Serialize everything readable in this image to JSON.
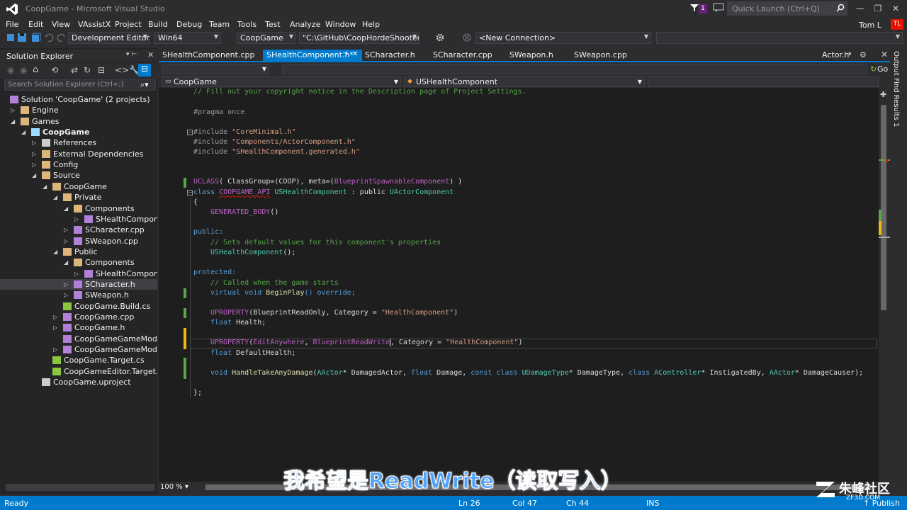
{
  "window": {
    "title": "CoopGame - Microsoft Visual Studio",
    "notification_count": "1",
    "quick_launch_placeholder": "Quick Launch (Ctrl+Q)",
    "user_name": "Tom L",
    "user_initials": "TL"
  },
  "menu": [
    "File",
    "Edit",
    "View",
    "VAssistX",
    "Project",
    "Build",
    "Debug",
    "Team",
    "Tools",
    "Test",
    "Analyze",
    "Window",
    "Help"
  ],
  "toolbar": {
    "configuration": "Development Editor",
    "platform": "Win64",
    "startup_project": "CoopGame",
    "path": "\"C:\\GitHub\\CoopHordeShooter\\Co",
    "connection": "<New Connection>"
  },
  "solution_explorer": {
    "title": "Solution Explorer",
    "search_placeholder": "Search Solution Explorer (Ctrl+;)",
    "items": [
      {
        "label": "Solution 'CoopGame' (2 projects)",
        "level": 0,
        "exp": "",
        "icon": "solution-icon"
      },
      {
        "label": "Engine",
        "level": 1,
        "exp": "▷",
        "icon": "folder-icon"
      },
      {
        "label": "Games",
        "level": 1,
        "exp": "◢",
        "icon": "folder-icon"
      },
      {
        "label": "CoopGame",
        "level": 2,
        "exp": "◢",
        "icon": "project-icon"
      },
      {
        "label": "References",
        "level": 3,
        "exp": "▷",
        "icon": "references-icon"
      },
      {
        "label": "External Dependencies",
        "level": 3,
        "exp": "▷",
        "icon": "external-deps-icon"
      },
      {
        "label": "Config",
        "level": 3,
        "exp": "▷",
        "icon": "folder-icon"
      },
      {
        "label": "Source",
        "level": 3,
        "exp": "◢",
        "icon": "folder-icon"
      },
      {
        "label": "CoopGame",
        "level": 4,
        "exp": "◢",
        "icon": "folder-icon"
      },
      {
        "label": "Private",
        "level": 5,
        "exp": "◢",
        "icon": "folder-icon"
      },
      {
        "label": "Components",
        "level": 6,
        "exp": "◢",
        "icon": "folder-icon"
      },
      {
        "label": "SHealthComponer",
        "level": 7,
        "exp": "▷",
        "icon": "cpp-file-icon"
      },
      {
        "label": "SCharacter.cpp",
        "level": 6,
        "exp": "▷",
        "icon": "cpp-file-icon"
      },
      {
        "label": "SWeapon.cpp",
        "level": 6,
        "exp": "▷",
        "icon": "cpp-file-icon"
      },
      {
        "label": "Public",
        "level": 5,
        "exp": "◢",
        "icon": "folder-icon"
      },
      {
        "label": "Components",
        "level": 6,
        "exp": "◢",
        "icon": "folder-icon"
      },
      {
        "label": "SHealthComponer",
        "level": 7,
        "exp": "▷",
        "icon": "header-file-icon"
      },
      {
        "label": "SCharacter.h",
        "level": 6,
        "exp": "▷",
        "icon": "header-file-icon",
        "selected": true
      },
      {
        "label": "SWeapon.h",
        "level": 6,
        "exp": "▷",
        "icon": "header-file-icon"
      },
      {
        "label": "CoopGame.Build.cs",
        "level": 5,
        "exp": "",
        "icon": "cs-file-icon"
      },
      {
        "label": "CoopGame.cpp",
        "level": 5,
        "exp": "▷",
        "icon": "cpp-file-icon"
      },
      {
        "label": "CoopGame.h",
        "level": 5,
        "exp": "▷",
        "icon": "header-file-icon"
      },
      {
        "label": "CoopGameGameModeBa",
        "level": 5,
        "exp": "",
        "icon": "cpp-file-icon"
      },
      {
        "label": "CoopGameGameModeBa",
        "level": 5,
        "exp": "▷",
        "icon": "header-file-icon"
      },
      {
        "label": "CoopGame.Target.cs",
        "level": 4,
        "exp": "",
        "icon": "cs-file-icon"
      },
      {
        "label": "CoopGameEditor.Target.cs",
        "level": 4,
        "exp": "",
        "icon": "cs-file-icon"
      },
      {
        "label": "CoopGame.uproject",
        "level": 3,
        "exp": "",
        "icon": "uproject-file-icon"
      }
    ]
  },
  "tabs": [
    {
      "label": "SHealthComponent.cpp",
      "active": false
    },
    {
      "label": "SHealthComponent.h*",
      "active": true
    },
    {
      "label": "SCharacter.h",
      "active": false
    },
    {
      "label": "SCharacter.cpp",
      "active": false
    },
    {
      "label": "SWeapon.h",
      "active": false
    },
    {
      "label": "SWeapon.cpp",
      "active": false
    },
    {
      "label": "Actor.h",
      "active": false
    }
  ],
  "nav": {
    "go_label": "Go",
    "project": "CoopGame",
    "scope": "USHealthComponent"
  },
  "code": {
    "l1": "// Fill out your copyright notice in the Description page of Project Settings.",
    "l2_kw": "#pragma once",
    "inc_kw": "#include ",
    "inc1": "\"CoreMinimal.h\"",
    "inc2": "\"Components/ActorComponent.h\"",
    "inc3": "\"SHealthComponent.generated.h\"",
    "uclass": "UCLASS",
    "uclass_args1": "( ClassGroup=(COOP), meta=(",
    "uclass_spec": "BlueprintSpawnableComponent",
    "uclass_args2": ") )",
    "class_kw": "class ",
    "api": "COOPGAME_API",
    "class_name": " USHealthComponent",
    "colon_public": " : public ",
    "base": "UActorComponent",
    "open_brace": "{",
    "gen_body": "GENERATED_BODY",
    "parens": "()",
    "public_kw": "public:",
    "comment1": "// Sets default values for this component's properties",
    "ctor": "USHealthComponent",
    "ctor_tail": "();",
    "protected_kw": "protected:",
    "comment2": "// Called when the game starts",
    "virtual_kw": "virtual void ",
    "beginplay": "BeginPlay",
    "override_tail": "() override;",
    "uprop": "UPROPERTY",
    "uprop1_args": "(BlueprintReadOnly, Category = ",
    "uprop_cat": "\"HealthComponent\"",
    "close_paren": ")",
    "float_kw": "float ",
    "health": "Health;",
    "uprop2_a": "EditAnywhere",
    "uprop2_b": "BlueprintReadWrite",
    "uprop2_c": ", Category = ",
    "default_health": "DefaultHealth;",
    "void_kw": "void ",
    "handler": "HandleTakeAnyDamage",
    "p_actor": "AActor",
    "p1": "* DamagedActor, ",
    "p_float": "float",
    "p2": " Damage, ",
    "p_const": "const class ",
    "p_dmg": "UDamageType",
    "p3": "* DamageType, ",
    "p_class": "class ",
    "p_ctrl": "AController",
    "p4": "* InstigatedBy, ",
    "p5": "* DamageCauser);",
    "close": "};"
  },
  "editor": {
    "zoom": "100 %"
  },
  "right_tabs": [
    "Output",
    "Find Results 1"
  ],
  "status": {
    "state": "Ready",
    "line": "Ln 26",
    "col": "Col 47",
    "ch": "Ch 44",
    "mode": "INS",
    "publish": "↑ Publish"
  },
  "subtitle": "我希望是ReadWrite（读取写入）",
  "watermark": {
    "brand": "朱峰社区",
    "site": "ZF3D.COM"
  }
}
